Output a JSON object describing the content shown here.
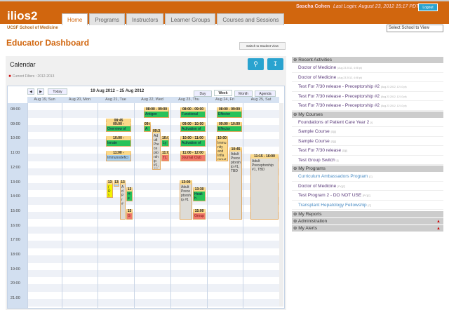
{
  "header": {
    "logo": "ilios2",
    "user": "Sascha Cohen",
    "last_login": "Last Login: August 23, 2012 15:17 PDT",
    "logout": "Logout",
    "tabs": [
      "Home",
      "Programs",
      "Instructors",
      "Learner Groups",
      "Courses and Sessions"
    ],
    "school": "UCSF School of Medicine",
    "school_select": "Select School to View"
  },
  "page": {
    "title": "Educator Dashboard",
    "switch_view": "Switch to Student View"
  },
  "calendar": {
    "title": "Calendar",
    "filters": "Current Filters : 2012-2013",
    "today": "Today",
    "range": "19 Aug 2012 – 25 Aug 2012",
    "views": [
      "Day",
      "Week",
      "Month",
      "Agenda"
    ],
    "days": [
      "Aug 19, Sun",
      "Aug 20, Mon",
      "Aug 21, Tue",
      "Aug 22, Wed",
      "Aug 23, Thu",
      "Aug 24, Fri",
      "Aug 25, Sat"
    ],
    "hours": [
      "08:00",
      "09:00",
      "10:00",
      "11:00",
      "12:00",
      "13:00",
      "14:00",
      "15:00",
      "16:00",
      "17:00",
      "18:00",
      "19:00",
      "20:00",
      "21:00"
    ],
    "events": [
      {
        "day": 2,
        "start": 8.75,
        "end": 9,
        "time": "08:45",
        "title": "",
        "color": "t"
      },
      {
        "day": 2,
        "start": 9,
        "end": 10,
        "time": "09:00 -",
        "title": "Overview of",
        "color": "g"
      },
      {
        "day": 2,
        "start": 10,
        "end": 11,
        "time": "10:00 -",
        "title": "Innate",
        "color": "g"
      },
      {
        "day": 2,
        "start": 11,
        "end": 12,
        "time": "11:00 -",
        "title": "Immunodefici",
        "color": "b"
      },
      {
        "day": 3,
        "start": 8,
        "end": 9,
        "time": "08:00 - 09:00",
        "title": "Antigen",
        "color": "g"
      },
      {
        "day": 3,
        "start": 9,
        "end": 10,
        "time": "09:0",
        "title": "Ant",
        "color": "g"
      },
      {
        "day": 3,
        "start": 9.5,
        "end": 12.6,
        "time": "09:3",
        "title": "Adult Preceptorship #1, TBD",
        "color": "gr"
      },
      {
        "day": 3,
        "start": 10,
        "end": 11,
        "time": "10:0",
        "title": "Lym",
        "color": "g"
      },
      {
        "day": 3,
        "start": 11,
        "end": 12,
        "time": "11:0",
        "title": "TLC",
        "color": "r"
      },
      {
        "day": 4,
        "start": 8,
        "end": 9,
        "time": "08:00 - 09:00",
        "title": "Functional",
        "color": "g"
      },
      {
        "day": 4,
        "start": 9,
        "end": 10,
        "time": "09:00 - 10:00",
        "title": "Activation of",
        "color": "g"
      },
      {
        "day": 4,
        "start": 10,
        "end": 11,
        "time": "10:00 - 11:00",
        "title": "Activation of",
        "color": "g"
      },
      {
        "day": 4,
        "start": 11,
        "end": 12,
        "time": "11:00 - 12:00",
        "title": "Journal Club",
        "color": "r"
      },
      {
        "day": 5,
        "start": 8,
        "end": 9,
        "time": "08:00 - 09:00",
        "title": "Effector",
        "color": "g"
      },
      {
        "day": 5,
        "start": 9,
        "end": 10,
        "time": "09:00 - 10:00",
        "title": "Effector",
        "color": "g"
      },
      {
        "day": 5,
        "start": 10,
        "end": 12,
        "time": "10:00",
        "title": "Immunity and Inflammation Laboratory",
        "color": "t"
      },
      {
        "day": 5,
        "start": 10.75,
        "end": 16,
        "time": "10:45",
        "title": "Adult Preceptorship #1, TBD",
        "color": "gr"
      },
      {
        "day": 6,
        "start": 11.25,
        "end": 16,
        "time": "11:15 - 16:00",
        "title": "Adult Preceptorship #1, TBD",
        "color": "gr"
      },
      {
        "day": 2,
        "start": 13,
        "end": 14.5,
        "time": "13",
        "title": "(R) Ol Ho Lt",
        "color": "y"
      },
      {
        "day": 2,
        "start": 13,
        "end": 13.5,
        "time": "13",
        "title": "Fi",
        "color": "b"
      },
      {
        "day": 2,
        "start": 13,
        "end": 16,
        "time": "13",
        "title": "Ad Pr #",
        "color": "gr"
      },
      {
        "day": 2,
        "start": 13.5,
        "end": 14.75,
        "time": "13",
        "title": "He Co",
        "color": "g"
      },
      {
        "day": 2,
        "start": 15,
        "end": 16,
        "time": "15",
        "title": "Gr Ch In an",
        "color": "r"
      },
      {
        "day": 4,
        "start": 13,
        "end": 16,
        "time": "13:00",
        "title": "Adult Preceptorship #1",
        "color": "gr"
      },
      {
        "day": 4,
        "start": 13.5,
        "end": 14.75,
        "time": "13:30",
        "title": "Health Communication",
        "color": "g"
      },
      {
        "day": 4,
        "start": 15,
        "end": 16,
        "time": "15:00",
        "title": "Group Check In and",
        "color": "r"
      }
    ]
  },
  "sidebar": {
    "recent": {
      "title": "Recent Activities",
      "items": [
        {
          "label": "Doctor of Medicine",
          "meta": "(Aug 23 2012, 4:08 pt)"
        },
        {
          "label": "Doctor of Medicine",
          "meta": "(Aug 23 2012, 4:08 pt)"
        },
        {
          "label": "Test For 7/30 release - Preceptorship #2",
          "meta": "(Aug 23 2012, 12:10 pt)"
        },
        {
          "label": "Test For 7/30 release - Preceptorship #2",
          "meta": "(Aug 23 2012, 12:10 pt)"
        },
        {
          "label": "Test For 7/30 release - Preceptorship #2",
          "meta": "(Aug 23 2012, 12:10 pt)"
        }
      ]
    },
    "courses": {
      "title": "My Courses",
      "items": [
        {
          "label": "Foundations of Patient Care Year 2",
          "meta": "[I]"
        },
        {
          "label": "Sample Course",
          "meta": "[D][I]"
        },
        {
          "label": "Sample Course",
          "meta": "[D][I]"
        },
        {
          "label": "Test For 7/30 release",
          "meta": "[D][I]"
        },
        {
          "label": "Test Group Switch",
          "meta": "[I]"
        }
      ]
    },
    "programs": {
      "title": "My Programs",
      "items": [
        {
          "label": "Curriculum Ambassadors Program",
          "meta": "[C]",
          "blue": true
        },
        {
          "label": "Doctor of Medicine",
          "meta": "[PY][C]"
        },
        {
          "label": "Test Program 2 - DO NOT USE",
          "meta": "[PY][C]"
        },
        {
          "label": "Transplant Hepatology Fellowship",
          "meta": "[C]",
          "blue": true
        }
      ]
    },
    "reports": "My Reports",
    "admin": "Administration",
    "alerts": "My Alerts"
  }
}
